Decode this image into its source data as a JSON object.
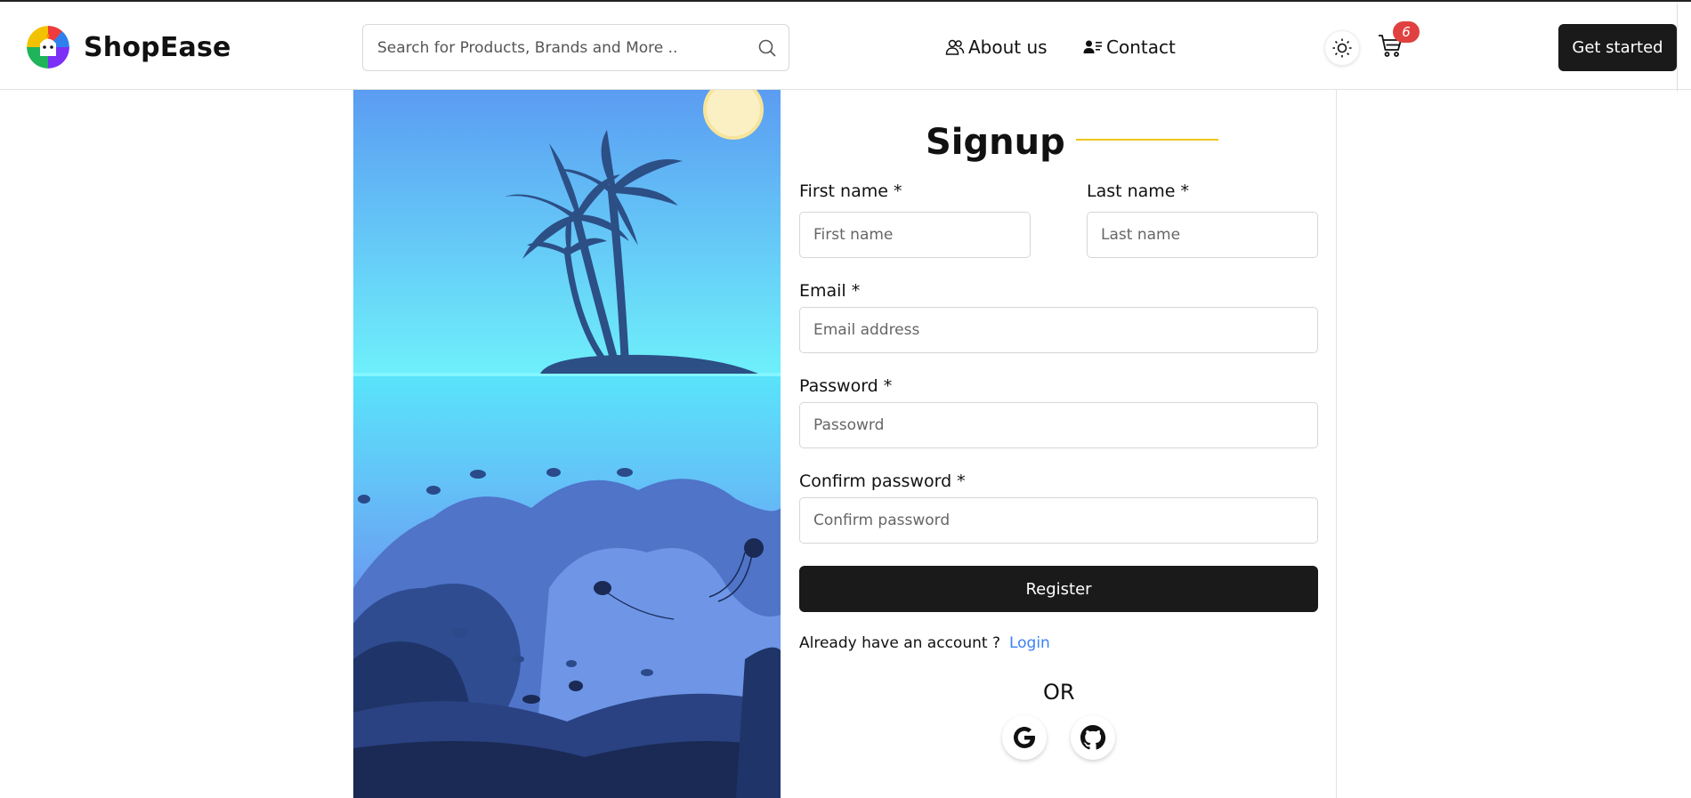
{
  "header": {
    "brand": "ShopEase",
    "search": {
      "placeholder": "Search for Products, Brands and More ..",
      "icon": "search-icon"
    },
    "nav": [
      {
        "label": "About us",
        "icon": "users-icon"
      },
      {
        "label": "Contact",
        "icon": "contact-card-icon"
      }
    ],
    "theme_toggle_icon": "sun-icon",
    "cart": {
      "icon": "cart-icon",
      "count": "6"
    },
    "cta_label": "Get started"
  },
  "illustration": {
    "description_icon": "tropical-island-underwater-illustration"
  },
  "form": {
    "title": "Signup",
    "first_name": {
      "label": "First name *",
      "placeholder": "First name"
    },
    "last_name": {
      "label": "Last name *",
      "placeholder": "Last name"
    },
    "email": {
      "label": "Email *",
      "placeholder": "Email address"
    },
    "password": {
      "label": "Password *",
      "placeholder": "Passowrd"
    },
    "confirm_password": {
      "label": "Confirm password *",
      "placeholder": "Confirm password"
    },
    "submit_label": "Register",
    "login_prompt": "Already have an account ?",
    "login_link": "Login",
    "or_text": "OR",
    "social": [
      {
        "name": "google",
        "icon": "google-icon"
      },
      {
        "name": "github",
        "icon": "github-icon"
      }
    ]
  },
  "colors": {
    "accent_line": "#f0c419",
    "primary_button": "#1a1a1a",
    "link": "#3b82f6",
    "badge": "#e0403f"
  }
}
